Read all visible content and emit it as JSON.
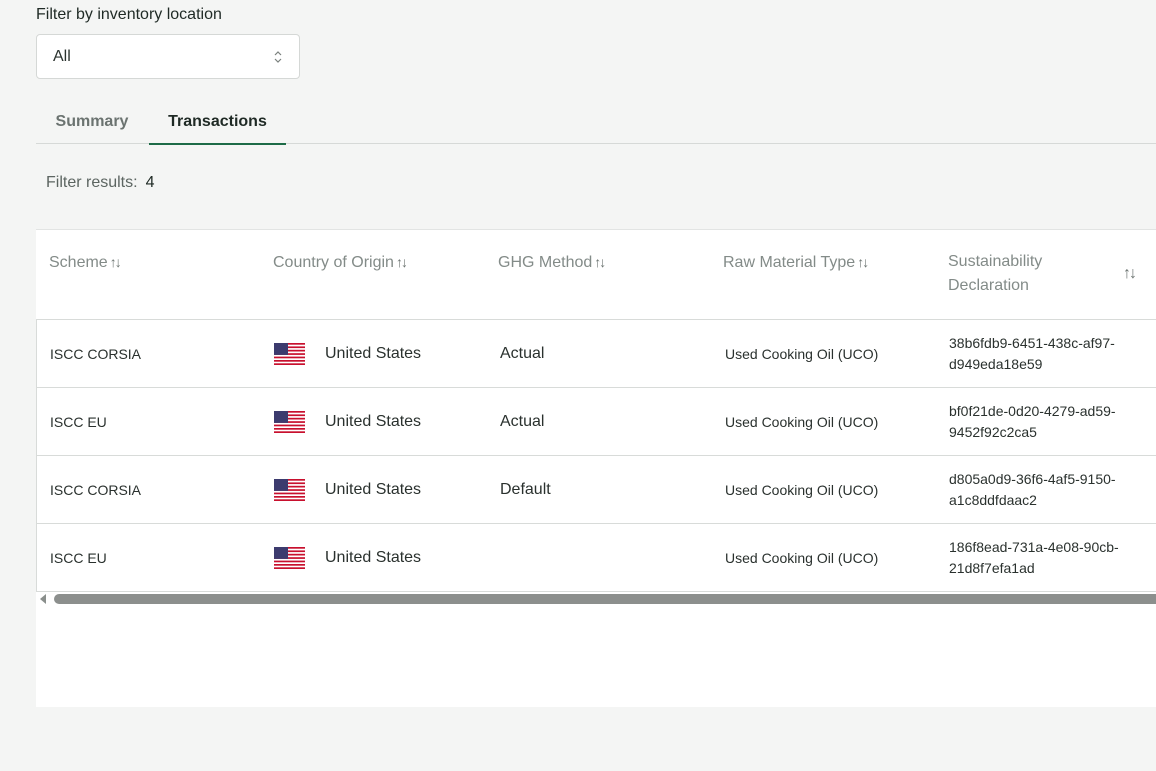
{
  "filter": {
    "label": "Filter by inventory location",
    "selected": "All"
  },
  "tabs": [
    {
      "label": "Summary",
      "active": false
    },
    {
      "label": "Transactions",
      "active": true
    }
  ],
  "results": {
    "label": "Filter results:",
    "count": "4"
  },
  "table": {
    "headers": {
      "scheme": "Scheme",
      "country": "Country of Origin",
      "ghg": "GHG Method",
      "raw": "Raw Material Type",
      "decl_line1": "Sustainability",
      "decl_line2": "Declaration"
    },
    "rows": [
      {
        "scheme": "ISCC CORSIA",
        "country": "United States",
        "ghg": "Actual",
        "raw": "Used Cooking Oil (UCO)",
        "decl1": "38b6fdb9-6451-438c-af97-",
        "decl2": "d949eda18e59"
      },
      {
        "scheme": "ISCC EU",
        "country": "United States",
        "ghg": "Actual",
        "raw": "Used Cooking Oil (UCO)",
        "decl1": "bf0f21de-0d20-4279-ad59-",
        "decl2": "9452f92c2ca5"
      },
      {
        "scheme": "ISCC CORSIA",
        "country": "United States",
        "ghg": "Default",
        "raw": "Used Cooking Oil (UCO)",
        "decl1": "d805a0d9-36f6-4af5-9150-",
        "decl2": "a1c8ddfdaac2"
      },
      {
        "scheme": "ISCC EU",
        "country": "United States",
        "ghg": "",
        "raw": "Used Cooking Oil (UCO)",
        "decl1": "186f8ead-731a-4e08-90cb-",
        "decl2": "21d8f7efa1ad"
      }
    ]
  },
  "icons": {
    "sort": "sort-arrows-icon",
    "select": "chevron-up-down-icon",
    "flag": "us-flag-icon"
  },
  "colors": {
    "active_tab_underline": "#1d6b47",
    "background": "#f4f5f4"
  }
}
